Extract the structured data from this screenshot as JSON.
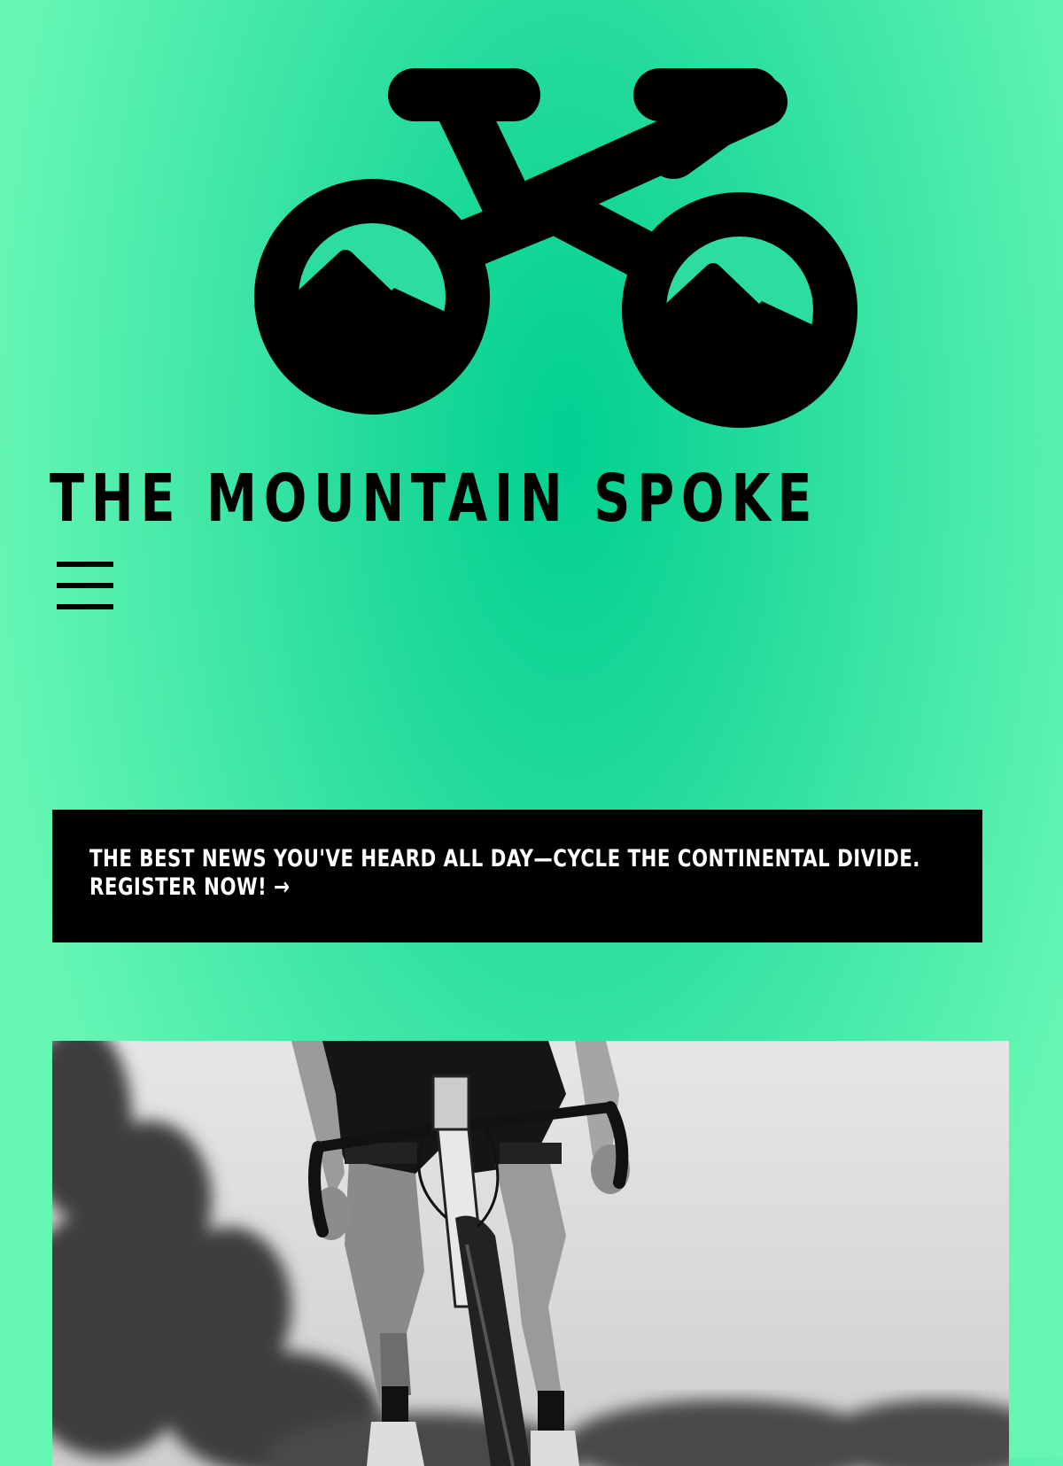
{
  "site": {
    "title": "THE MOUNTAIN SPOKE",
    "logo_icon": "mountain-bike-logo-icon",
    "menu_icon": "hamburger-menu-icon"
  },
  "banner": {
    "line1": "THE BEST NEWS YOU'VE HEARD ALL DAY—CYCLE THE CONTINENTAL DIVIDE.",
    "link": "REGISTER NOW! →"
  },
  "hero": {
    "image": "cyclist-riding-road-bike-photo"
  },
  "colors": {
    "accent": "#00d092",
    "accent_light": "#66f6b4",
    "banner_bg": "#000000",
    "banner_text": "#ffffff"
  }
}
